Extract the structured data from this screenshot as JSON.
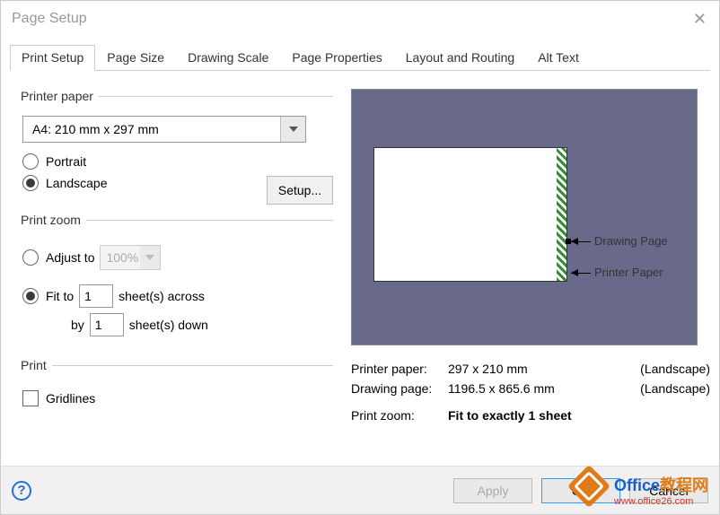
{
  "window": {
    "title": "Page Setup"
  },
  "tabs": {
    "t0": "Print Setup",
    "t1": "Page Size",
    "t2": "Drawing Scale",
    "t3": "Page Properties",
    "t4": "Layout and Routing",
    "t5": "Alt Text"
  },
  "printerPaper": {
    "legend": "Printer paper",
    "size": "A4:  210 mm x 297 mm",
    "portrait": "Portrait",
    "landscape": "Landscape",
    "setup": "Setup..."
  },
  "printZoom": {
    "legend": "Print zoom",
    "adjustTo": "Adjust to",
    "percent": "100%",
    "fitTo": "Fit to",
    "across": "1",
    "acrossLabel": "sheet(s) across",
    "by": "by",
    "down": "1",
    "downLabel": "sheet(s) down"
  },
  "print": {
    "legend": "Print",
    "gridlines": "Gridlines"
  },
  "preview": {
    "drawingPage": "Drawing Page",
    "printerPaper": "Printer Paper"
  },
  "info": {
    "printerPaperLabel": "Printer paper:",
    "printerPaperValue": "297 x 210 mm",
    "printerPaperOrient": "(Landscape)",
    "drawingPageLabel": "Drawing page:",
    "drawingPageValue": "1196.5 x 865.6 mm",
    "drawingPageOrient": "(Landscape)",
    "printZoomLabel": "Print zoom:",
    "printZoomValue": "Fit to exactly 1 sheet"
  },
  "footer": {
    "apply": "Apply",
    "ok": "OK",
    "cancel": "Cancel"
  },
  "watermark": {
    "line1a": "Office",
    "line1b": "教程网",
    "line2": "www.office26.com"
  }
}
